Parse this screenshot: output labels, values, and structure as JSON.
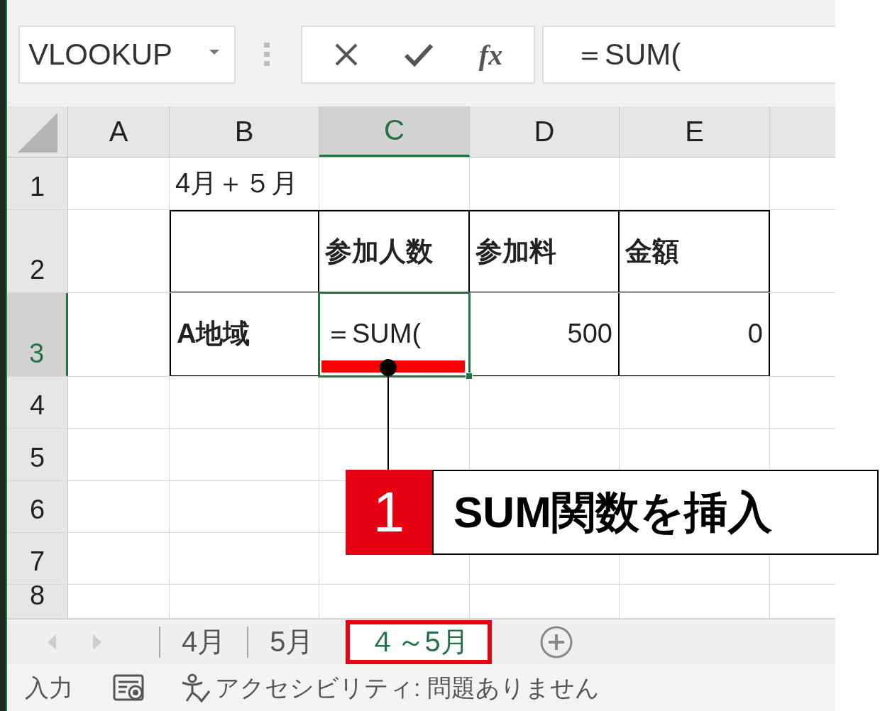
{
  "name_box": {
    "value": "VLOOKUP"
  },
  "formula_bar": {
    "function_label": "fx",
    "value": "＝SUM("
  },
  "columns": [
    {
      "label": "A",
      "selected": false
    },
    {
      "label": "B",
      "selected": false
    },
    {
      "label": "C",
      "selected": true
    },
    {
      "label": "D",
      "selected": false
    },
    {
      "label": "E",
      "selected": false
    }
  ],
  "rows": [
    {
      "label": "1",
      "selected": false,
      "column_b": {
        "text": "4月＋５月",
        "kind": "text",
        "selected": false
      }
    },
    {
      "label": "2",
      "selected": false,
      "column_c": {
        "text": "参加人数",
        "kind": "header",
        "selected": false
      },
      "column_d": {
        "text": "参加料",
        "kind": "header",
        "selected": false
      },
      "column_e": {
        "text": "金額",
        "kind": "header",
        "selected": false
      }
    },
    {
      "label": "3",
      "selected": true,
      "column_b": {
        "text": "A地域",
        "kind": "header",
        "selected": false
      },
      "column_c": {
        "text": "＝SUM(",
        "kind": "text",
        "selected": true
      },
      "column_d": {
        "text": "500",
        "kind": "number",
        "selected": false
      },
      "column_e": {
        "text": "0",
        "kind": "number",
        "selected": false
      }
    },
    {
      "label": "4",
      "selected": false
    },
    {
      "label": "5",
      "selected": false
    },
    {
      "label": "6",
      "selected": false
    },
    {
      "label": "7",
      "selected": false
    },
    {
      "label": "8",
      "selected": false
    }
  ],
  "sheet_tabs": [
    {
      "label": "4月",
      "selected": false
    },
    {
      "label": "5月",
      "selected": false
    },
    {
      "label": "４～5月",
      "selected": true
    }
  ],
  "status_bar": {
    "mode": "入力",
    "accessibility": "アクセシビリティ: 問題ありません"
  },
  "callout": {
    "number": "1",
    "text": "SUM関数を挿入"
  }
}
